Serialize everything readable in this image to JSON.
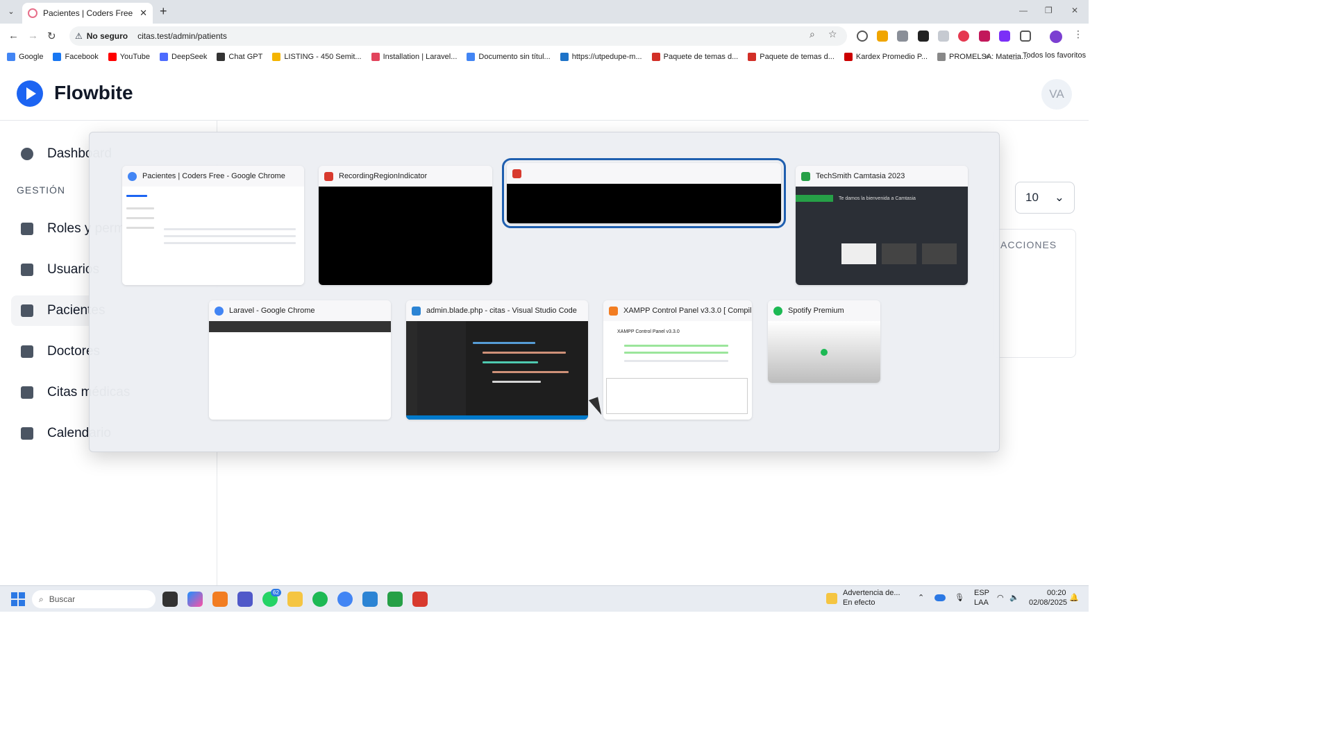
{
  "browser": {
    "tab_title": "Pacientes | Coders Free",
    "new_tab": "+",
    "security": "No seguro",
    "url": "citas.test/admin/patients",
    "bookmarks": [
      {
        "label": "Google",
        "color": "#4285f4"
      },
      {
        "label": "Facebook",
        "color": "#1877f2"
      },
      {
        "label": "YouTube",
        "color": "#ff0000"
      },
      {
        "label": "DeepSeek",
        "color": "#4d6bfe"
      },
      {
        "label": "Chat GPT",
        "color": "#333333"
      },
      {
        "label": "LISTING - 450 Semit...",
        "color": "#f4b400"
      },
      {
        "label": "Installation | Laravel...",
        "color": "#e2445c"
      },
      {
        "label": "Documento sin títul...",
        "color": "#4285f4"
      },
      {
        "label": "https://utpedupe-m...",
        "color": "#1e73c8"
      },
      {
        "label": "Paquete de temas d...",
        "color": "#d22f27"
      },
      {
        "label": "Paquete de temas d...",
        "color": "#d22f27"
      },
      {
        "label": "Kardex Promedio P...",
        "color": "#cc0000"
      },
      {
        "label": "PROMELSA: Materia...",
        "color": "#888888"
      }
    ],
    "bookmarks_more": "»",
    "all_bookmarks": "Todos los favoritos"
  },
  "app": {
    "brand": "Flowbite",
    "avatar": "VA",
    "section_label": "GESTIÓN",
    "sidebar": [
      {
        "label": "Dashboard",
        "icon": "chart-pie-icon"
      },
      {
        "label": "Roles y permisos",
        "icon": "shield-icon"
      },
      {
        "label": "Usuarios",
        "icon": "users-icon"
      },
      {
        "label": "Pacientes",
        "icon": "patient-icon"
      },
      {
        "label": "Doctores",
        "icon": "doctor-icon"
      },
      {
        "label": "Citas médicas",
        "icon": "calendar-check-icon"
      },
      {
        "label": "Calendario",
        "icon": "calendar-icon"
      }
    ],
    "per_page": "10",
    "card_header": "ACCIONES"
  },
  "switcher": {
    "windows": [
      {
        "title": "Pacientes | Coders Free - Google Chrome",
        "icon": "chrome-icon",
        "color": "#4285f4"
      },
      {
        "title": "RecordingRegionIndicator",
        "icon": "camtasia-recorder-icon",
        "color": "#d83a2e"
      },
      {
        "title": "",
        "icon": "camtasia-recorder-icon",
        "color": "#d83a2e"
      },
      {
        "title": "TechSmith Camtasia 2023",
        "icon": "camtasia-icon",
        "color": "#26a047"
      },
      {
        "title": "Laravel - Google Chrome",
        "icon": "chrome-icon",
        "color": "#4285f4"
      },
      {
        "title": "admin.blade.php - citas - Visual Studio Code",
        "icon": "vscode-icon",
        "color": "#2c84d4"
      },
      {
        "title": "XAMPP Control Panel v3.3.0   [ Compil...",
        "icon": "xampp-icon",
        "color": "#f27d22"
      },
      {
        "title": "Spotify Premium",
        "icon": "spotify-icon",
        "color": "#1db954"
      }
    ],
    "camtasia_welcome": "Te damos la bienvenida a Camtasia",
    "xampp_heading": "XAMPP Control Panel v3.3.0"
  },
  "taskbar": {
    "search": "Buscar",
    "whatsapp_badge": "62",
    "weather_title": "Advertencia de...",
    "weather_sub": "En efecto",
    "lang": "ESP",
    "lang2": "LAA",
    "time": "00:20",
    "date": "02/08/2025"
  }
}
